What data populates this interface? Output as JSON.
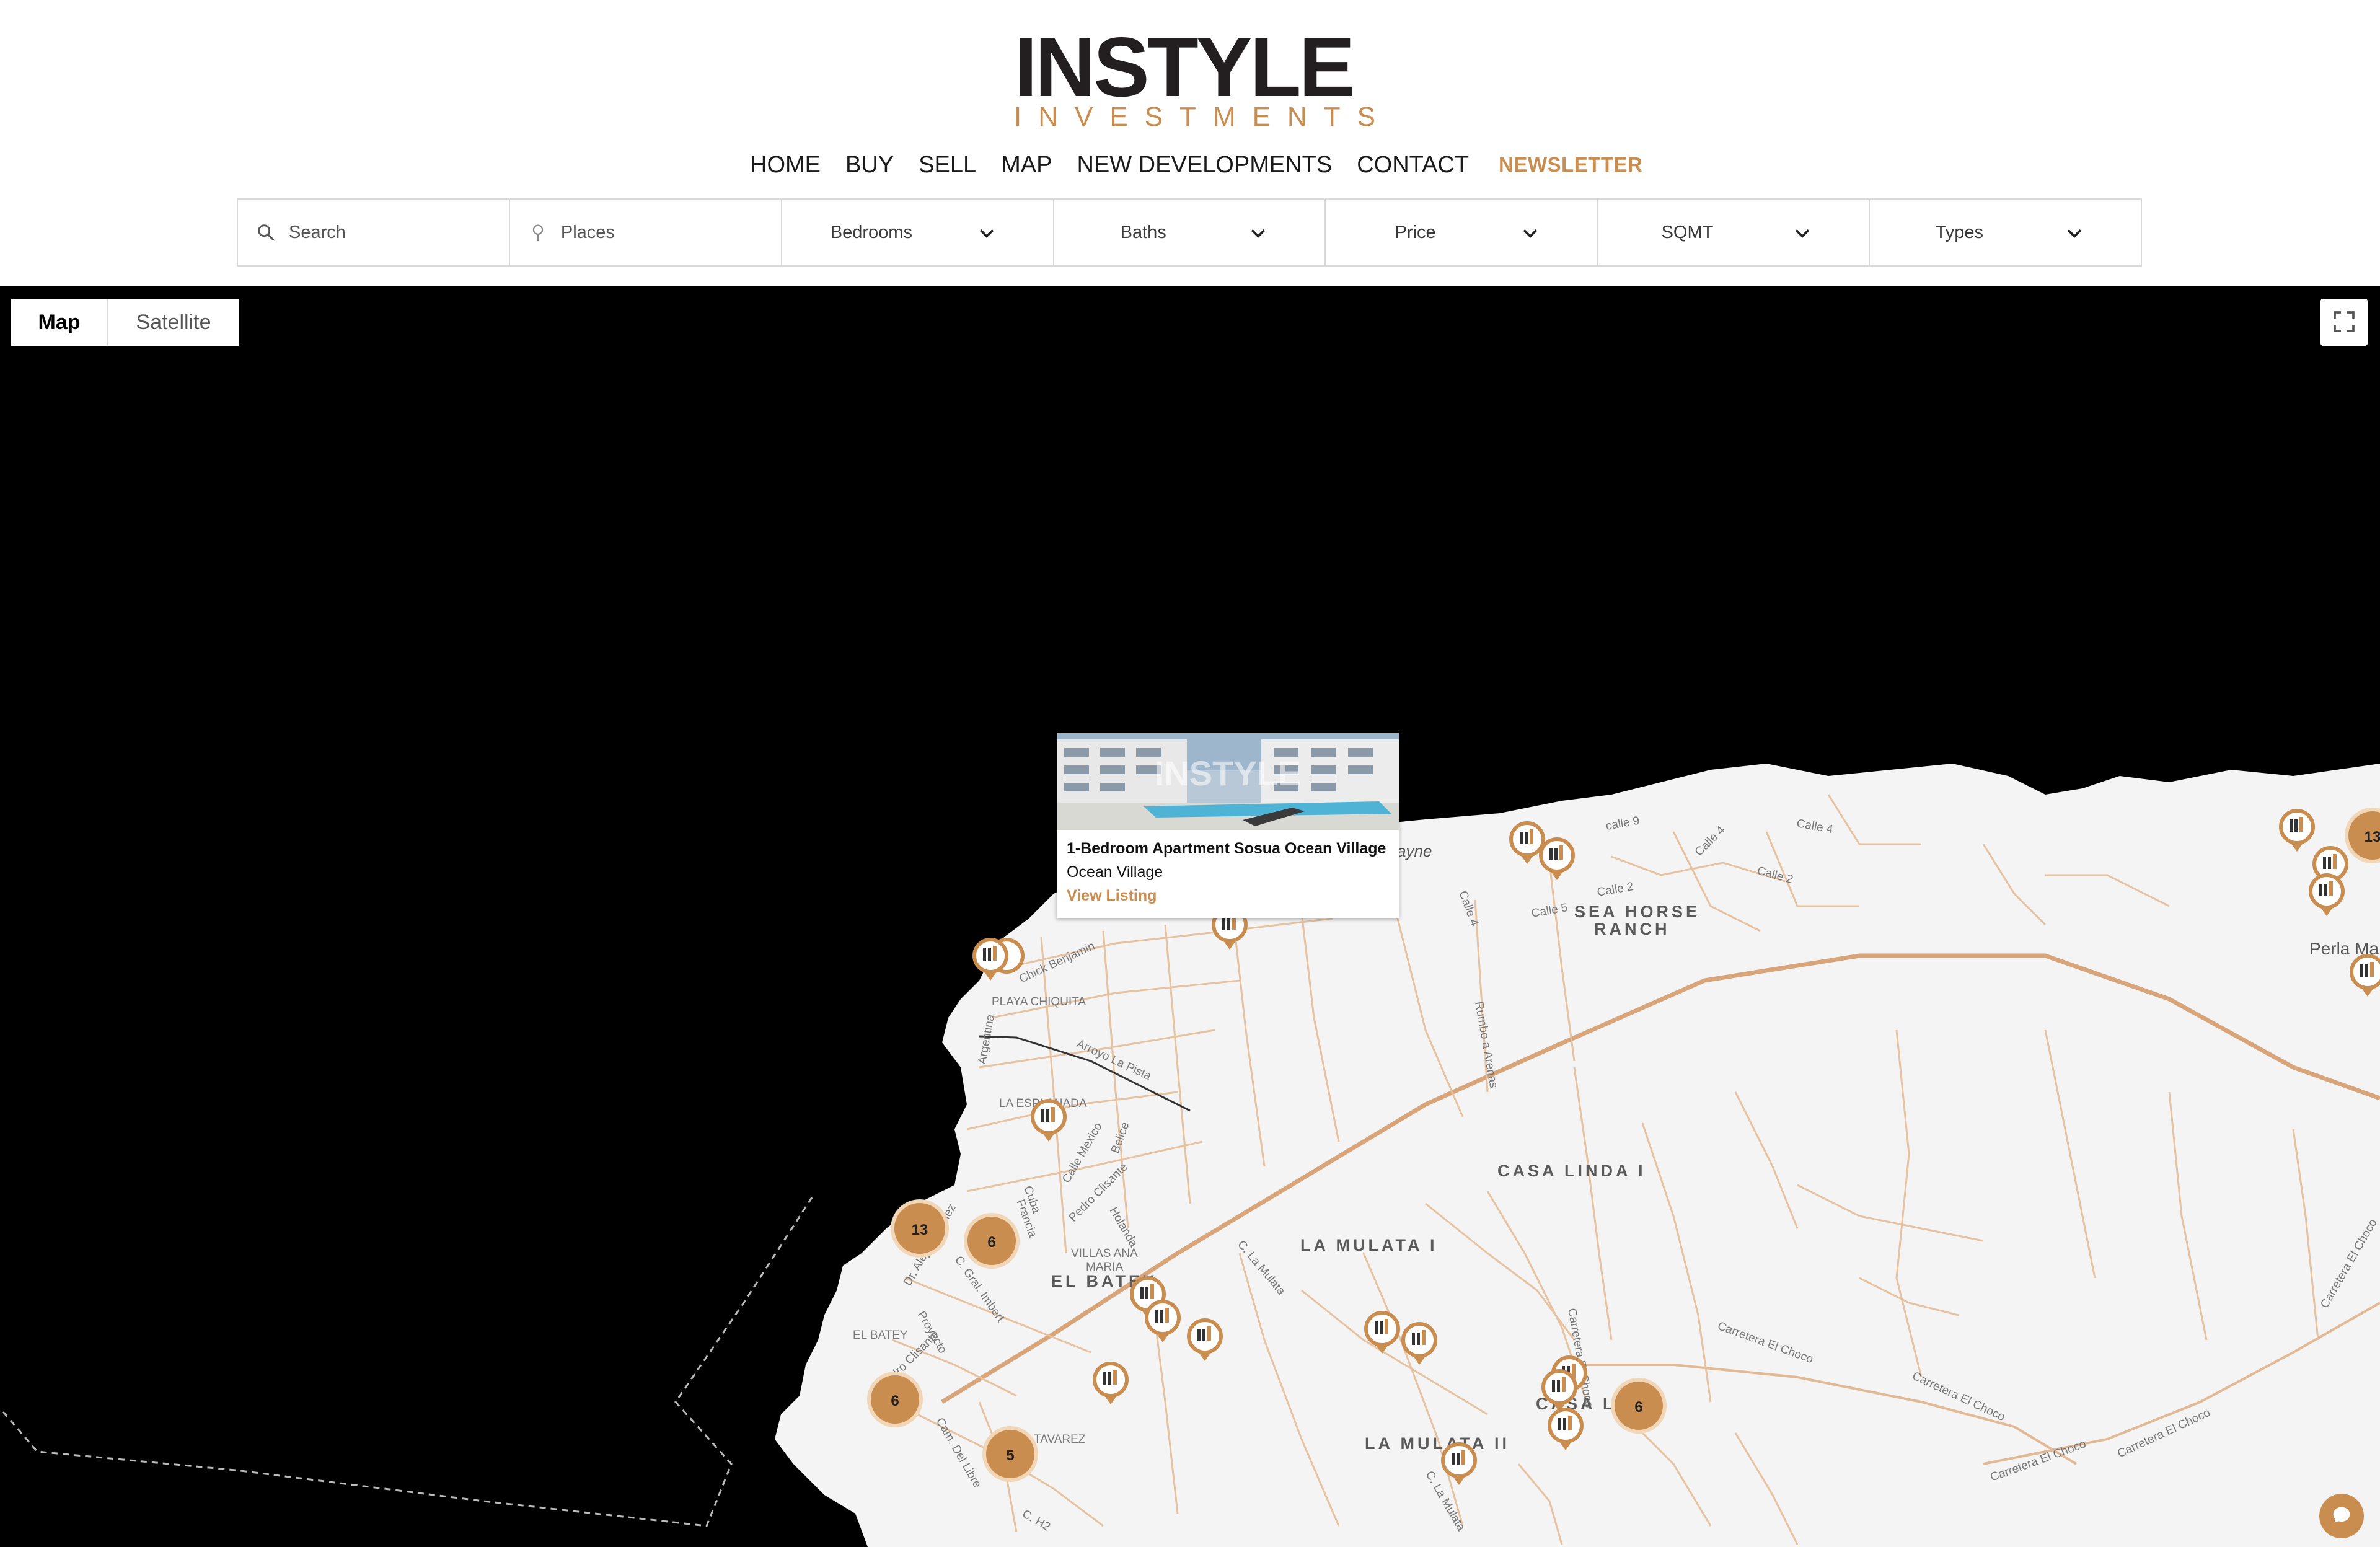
{
  "header": {
    "logo_word": "INSTYLE",
    "logo_sub": "INVESTMENTS"
  },
  "nav": {
    "items": [
      "HOME",
      "BUY",
      "SELL",
      "MAP",
      "NEW DEVELOPMENTS",
      "CONTACT"
    ],
    "newsletter": "NEWSLETTER"
  },
  "filters": {
    "search_placeholder": "Search",
    "places_placeholder": "Places",
    "bedrooms": "Bedrooms",
    "baths": "Baths",
    "price": "Price",
    "sqmt": "SQMT",
    "types": "Types"
  },
  "map": {
    "type_map": "Map",
    "type_satellite": "Satellite",
    "areas": [
      "SEA HORSE",
      "RANCH",
      "CASA LINDA I",
      "LA MULATA I",
      "LA MULATA II",
      "EL BATEY",
      "PLAYA CHIQUITA",
      "LA ESPLANADA",
      "VILLAS ANA",
      "MARIA",
      "TAVAREZ",
      "EL BATEY",
      "Perla Ma",
      "ayne",
      "CASA LI"
    ],
    "streets": [
      "calle 9",
      "Calle 4",
      "Calle 4",
      "Calle 2",
      "Calle 2",
      "Calle 5",
      "Calle 4",
      "Rumbo a Arenas",
      "Chick Benjamin",
      "Arroyo La Pista",
      "Argentina",
      "Calle Mexico",
      "Belice",
      "Pedro Clisante",
      "Cuba",
      "Francia",
      "Holanda",
      "C. Gral. Imbert",
      "Dr. Alejo Martinez",
      "Proyecto",
      "Pedro Clisante",
      "Cam. Del Libre",
      "C. H2",
      "C. La Mulata",
      "C. La Mulata",
      "Carretera El Choco",
      "Carretera El Choco",
      "Carretera El Choco",
      "Carretera El Choco",
      "Carretera El Choco",
      "Carretera El Choco"
    ],
    "clusters": [
      "13",
      "6",
      "6",
      "5",
      "6",
      "13"
    ],
    "popup": {
      "title": "1-Bedroom Apartment Sosua Ocean Village",
      "subtitle": "Ocean Village",
      "link": "View Listing",
      "image_watermark": "INSTYLE"
    }
  },
  "colors": {
    "accent": "#c98d50",
    "map_land": "#f4f4f4",
    "map_water": "#000000",
    "road": "#e0b48a"
  }
}
